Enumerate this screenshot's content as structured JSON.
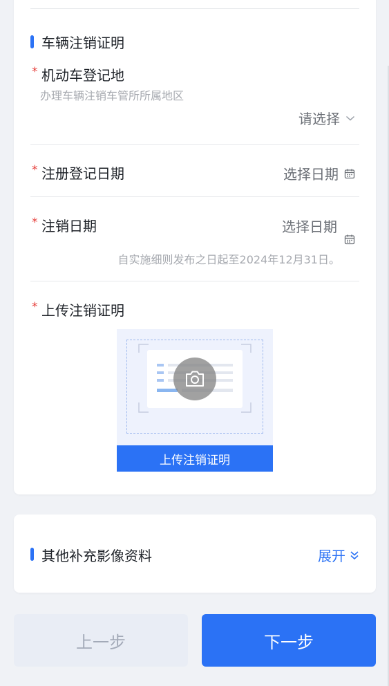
{
  "section_cancel": {
    "title": "车辆注销证明",
    "reg_place": {
      "required_mark": "*",
      "label": "机动车登记地",
      "hint": "办理车辆注销车管所所属地区",
      "picker_text": "请选择"
    },
    "reg_date": {
      "required_mark": "*",
      "label": "注册登记日期",
      "picker_text": "选择日期"
    },
    "cancel_date": {
      "required_mark": "*",
      "label": "注销日期",
      "picker_text": "选择日期",
      "hint": "自实施细则发布之日起至2024年12月31日。"
    },
    "upload": {
      "required_mark": "*",
      "label": "上传注销证明",
      "button_text": "上传注销证明"
    }
  },
  "section_extra": {
    "title": "其他补充影像资料",
    "expand_label": "展开"
  },
  "footer": {
    "prev_label": "上一步",
    "next_label": "下一步"
  },
  "colors": {
    "accent": "#2b72f5",
    "required": "#e53935",
    "background": "#f0f2f6",
    "prev_button_bg": "#e9edf5"
  },
  "icons": [
    "chevron-down-icon",
    "calendar-icon",
    "camera-icon",
    "double-chevron-down-icon"
  ]
}
